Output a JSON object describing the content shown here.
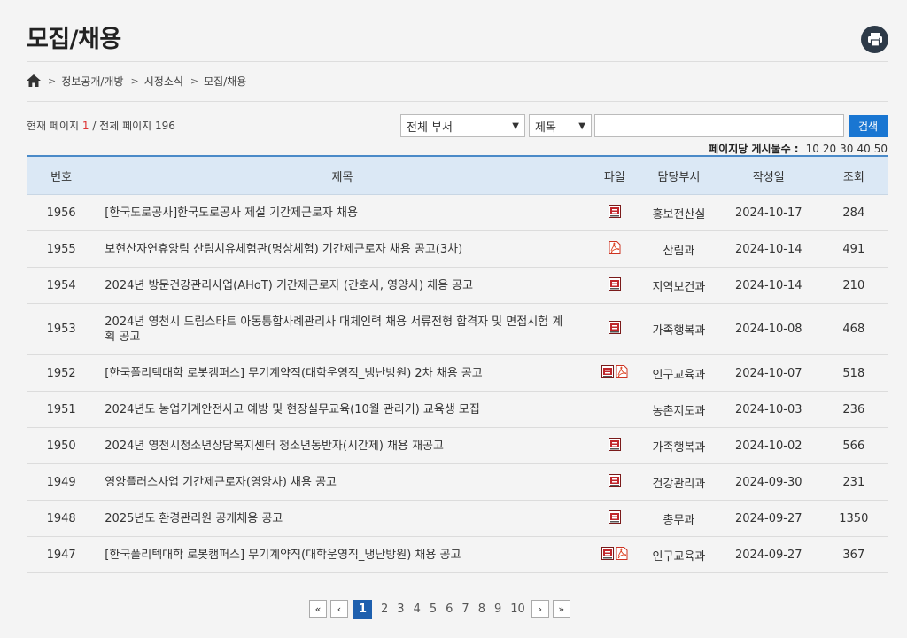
{
  "page": {
    "title": "모집/채용",
    "print_icon": "printer-icon",
    "breadcrumb": {
      "home_icon": "home-icon",
      "items": [
        "정보공개/개방",
        "시정소식",
        "모집/채용"
      ]
    },
    "page_info": {
      "prefix": "현재 페이지",
      "current": "1",
      "middle": "/ 전체 페이지",
      "total": "196"
    }
  },
  "search": {
    "dept_select": "전체 부서",
    "field_select": "제목",
    "query": "",
    "button": "검색"
  },
  "per_page": {
    "label": "페이지당 게시물수 :",
    "options": [
      "10",
      "20",
      "30",
      "40",
      "50"
    ]
  },
  "table": {
    "headers": [
      "번호",
      "제목",
      "파일",
      "담당부서",
      "작성일",
      "조회"
    ],
    "rows": [
      {
        "no": "1956",
        "subject": "[한국도로공사]한국도로공사 제설 기간제근로자 채용",
        "files": [
          "hwp-file-icon"
        ],
        "dept": "홍보전산실",
        "date": "2024-10-17",
        "views": "284"
      },
      {
        "no": "1955",
        "subject": "보현산자연휴양림 산림치유체험관(명상체험) 기간제근로자 채용 공고(3차)",
        "files": [
          "pdf-file-icon"
        ],
        "dept": "산림과",
        "date": "2024-10-14",
        "views": "491"
      },
      {
        "no": "1954",
        "subject": "2024년 방문건강관리사업(AHoT) 기간제근로자 (간호사, 영양사) 채용 공고",
        "files": [
          "hwp-file-icon"
        ],
        "dept": "지역보건과",
        "date": "2024-10-14",
        "views": "210"
      },
      {
        "no": "1953",
        "subject": "2024년 영천시 드림스타트 아동통합사례관리사 대체인력 채용 서류전형 합격자 및 면접시험 계획 공고",
        "files": [
          "hwp-file-icon"
        ],
        "dept": "가족행복과",
        "date": "2024-10-08",
        "views": "468"
      },
      {
        "no": "1952",
        "subject": "[한국폴리텍대학 로봇캠퍼스] 무기계약직(대학운영직_냉난방원) 2차 채용 공고",
        "files": [
          "hwp-file-icon",
          "pdf-file-icon"
        ],
        "dept": "인구교육과",
        "date": "2024-10-07",
        "views": "518"
      },
      {
        "no": "1951",
        "subject": "2024년도 농업기계안전사고 예방 및 현장실무교육(10월 관리기) 교육생 모집",
        "files": [],
        "dept": "농촌지도과",
        "date": "2024-10-03",
        "views": "236"
      },
      {
        "no": "1950",
        "subject": "2024년 영천시청소년상담복지센터 청소년동반자(시간제) 채용 재공고",
        "files": [
          "hwp-file-icon"
        ],
        "dept": "가족행복과",
        "date": "2024-10-02",
        "views": "566"
      },
      {
        "no": "1949",
        "subject": "영양플러스사업 기간제근로자(영양사) 채용 공고",
        "files": [
          "hwp-file-icon"
        ],
        "dept": "건강관리과",
        "date": "2024-09-30",
        "views": "231"
      },
      {
        "no": "1948",
        "subject": "2025년도 환경관리원 공개채용 공고",
        "files": [
          "hwp-file-icon"
        ],
        "dept": "총무과",
        "date": "2024-09-27",
        "views": "1350"
      },
      {
        "no": "1947",
        "subject": "[한국폴리텍대학 로봇캠퍼스] 무기계약직(대학운영직_냉난방원) 채용 공고",
        "files": [
          "hwp-file-icon",
          "pdf-file-icon"
        ],
        "dept": "인구교육과",
        "date": "2024-09-27",
        "views": "367"
      }
    ]
  },
  "pagination": {
    "first": "«",
    "prev": "‹",
    "pages": [
      "1",
      "2",
      "3",
      "4",
      "5",
      "6",
      "7",
      "8",
      "9",
      "10"
    ],
    "current": "1",
    "next": "›",
    "last": "»"
  },
  "colors": {
    "accent": "#1976d2",
    "header_bg": "#dbe8f5",
    "active_page": "#1d5fae",
    "current_page_text": "#dd3333"
  }
}
